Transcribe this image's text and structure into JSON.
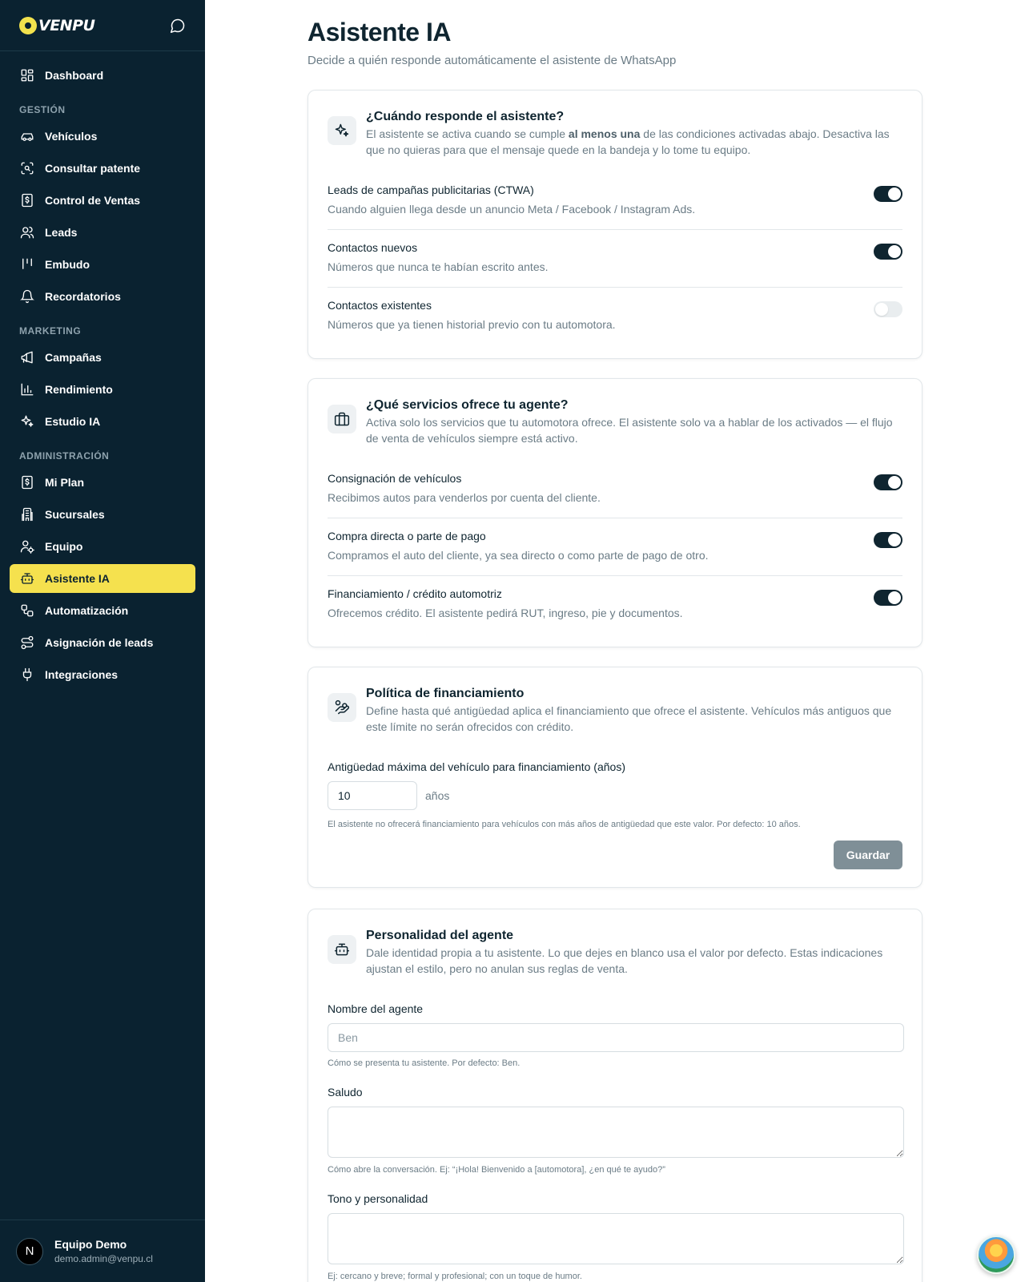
{
  "brand": {
    "name": "VENPU"
  },
  "sidebar": {
    "top_items": [
      {
        "label": "Dashboard",
        "icon": "grid-icon"
      }
    ],
    "sections": [
      {
        "title": "GESTIÓN",
        "items": [
          {
            "label": "Vehículos",
            "icon": "car-icon"
          },
          {
            "label": "Consultar patente",
            "icon": "scan-icon"
          },
          {
            "label": "Control de Ventas",
            "icon": "dollar-receipt-icon"
          },
          {
            "label": "Leads",
            "icon": "users-icon"
          },
          {
            "label": "Embudo",
            "icon": "kanban-icon"
          },
          {
            "label": "Recordatorios",
            "icon": "bell-icon"
          }
        ]
      },
      {
        "title": "MARKETING",
        "items": [
          {
            "label": "Campañas",
            "icon": "megaphone-icon"
          },
          {
            "label": "Rendimiento",
            "icon": "bar-chart-icon"
          },
          {
            "label": "Estudio IA",
            "icon": "sparkles-icon"
          }
        ]
      },
      {
        "title": "ADMINISTRACIÓN",
        "items": [
          {
            "label": "Mi Plan",
            "icon": "dollar-receipt-icon"
          },
          {
            "label": "Sucursales",
            "icon": "building-icon"
          },
          {
            "label": "Equipo",
            "icon": "user-cog-icon"
          },
          {
            "label": "Asistente IA",
            "icon": "bot-icon",
            "active": true
          },
          {
            "label": "Automatización",
            "icon": "workflow-icon"
          },
          {
            "label": "Asignación de leads",
            "icon": "route-icon"
          },
          {
            "label": "Integraciones",
            "icon": "plug-icon"
          }
        ]
      }
    ],
    "user": {
      "initial": "N",
      "name": "Equipo Demo",
      "email": "demo.admin@venpu.cl"
    }
  },
  "page": {
    "title": "Asistente IA",
    "subtitle": "Decide a quién responde automáticamente el asistente de WhatsApp"
  },
  "card_when": {
    "title": "¿Cuándo responde el asistente?",
    "desc_before": "El asistente se activa cuando se cumple ",
    "desc_bold": "al menos una",
    "desc_after": " de las condiciones activadas abajo. Desactiva las que no quieras para que el mensaje quede en la bandeja y lo tome tu equipo.",
    "toggles": [
      {
        "label": "Leads de campañas publicitarias (CTWA)",
        "desc": "Cuando alguien llega desde un anuncio Meta / Facebook / Instagram Ads.",
        "on": true
      },
      {
        "label": "Contactos nuevos",
        "desc": "Números que nunca te habían escrito antes.",
        "on": true
      },
      {
        "label": "Contactos existentes",
        "desc": "Números que ya tienen historial previo con tu automotora.",
        "on": false
      }
    ]
  },
  "card_services": {
    "title": "¿Qué servicios ofrece tu agente?",
    "desc": "Activa solo los servicios que tu automotora ofrece. El asistente solo va a hablar de los activados — el flujo de venta de vehículos siempre está activo.",
    "toggles": [
      {
        "label": "Consignación de vehículos",
        "desc": "Recibimos autos para venderlos por cuenta del cliente.",
        "on": true
      },
      {
        "label": "Compra directa o parte de pago",
        "desc": "Compramos el auto del cliente, ya sea directo o como parte de pago de otro.",
        "on": true
      },
      {
        "label": "Financiamiento / crédito automotriz",
        "desc": "Ofrecemos crédito. El asistente pedirá RUT, ingreso, pie y documentos.",
        "on": true
      }
    ]
  },
  "card_finance": {
    "title": "Política de financiamiento",
    "desc": "Define hasta qué antigüedad aplica el financiamiento que ofrece el asistente. Vehículos más antiguos que este límite no serán ofrecidos con crédito.",
    "field_label": "Antigüedad máxima del vehículo para financiamiento (años)",
    "value": "10",
    "unit": "años",
    "hint": "El asistente no ofrecerá financiamiento para vehículos con más años de antigüedad que este valor. Por defecto: 10 años.",
    "save_label": "Guardar"
  },
  "card_personality": {
    "title": "Personalidad del agente",
    "desc": "Dale identidad propia a tu asistente. Lo que dejes en blanco usa el valor por defecto. Estas indicaciones ajustan el estilo, pero no anulan sus reglas de venta.",
    "name_label": "Nombre del agente",
    "name_placeholder": "Ben",
    "name_hint": "Cómo se presenta tu asistente. Por defecto: Ben.",
    "greeting_label": "Saludo",
    "greeting_hint": "Cómo abre la conversación. Ej: “¡Hola! Bienvenido a [automotora], ¿en qué te ayudo?”",
    "tone_label": "Tono y personalidad",
    "tone_hint": "Ej: cercano y breve; formal y profesional; con un toque de humor."
  },
  "colors": {
    "sidebar_bg": "#0a2230",
    "accent": "#f5e14e",
    "toggle_on": "#0f2530"
  }
}
